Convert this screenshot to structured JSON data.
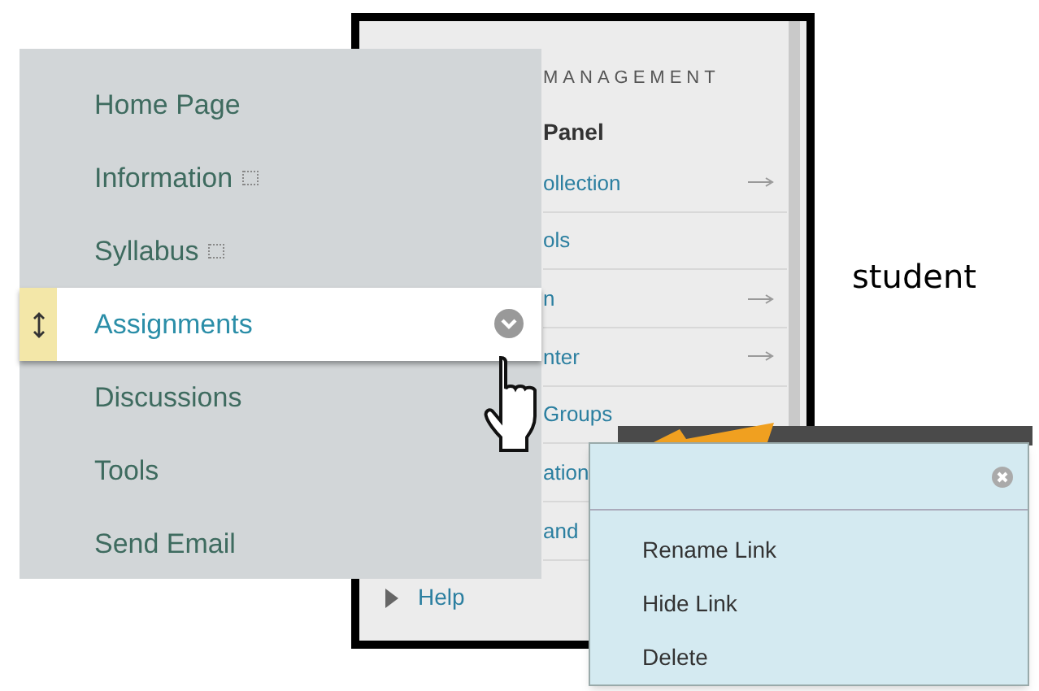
{
  "back_panel": {
    "heading": "MANAGEMENT",
    "subheading": "Panel",
    "items": [
      {
        "label": "ollection",
        "arrow": true
      },
      {
        "label": "ols",
        "arrow": false
      },
      {
        "label": "n",
        "arrow": true
      },
      {
        "label": "nter",
        "arrow": true
      },
      {
        "label": "Groups",
        "arrow": false
      },
      {
        "label": "ation",
        "arrow": false
      },
      {
        "label": "and",
        "arrow": false
      }
    ],
    "footer": "Help"
  },
  "course_menu": {
    "items": [
      {
        "label": "Home Page",
        "selected": false,
        "flagged": false
      },
      {
        "label": "Information",
        "selected": false,
        "flagged": true
      },
      {
        "label": "Syllabus",
        "selected": false,
        "flagged": true
      },
      {
        "label": "Assignments",
        "selected": true,
        "flagged": false
      },
      {
        "label": "Discussions",
        "selected": false,
        "flagged": false
      },
      {
        "label": "Tools",
        "selected": false,
        "flagged": false
      },
      {
        "label": "Send Email",
        "selected": false,
        "flagged": false
      }
    ]
  },
  "caption": "student",
  "context_menu": {
    "items": [
      "Rename Link",
      "Hide Link",
      "Delete"
    ]
  }
}
